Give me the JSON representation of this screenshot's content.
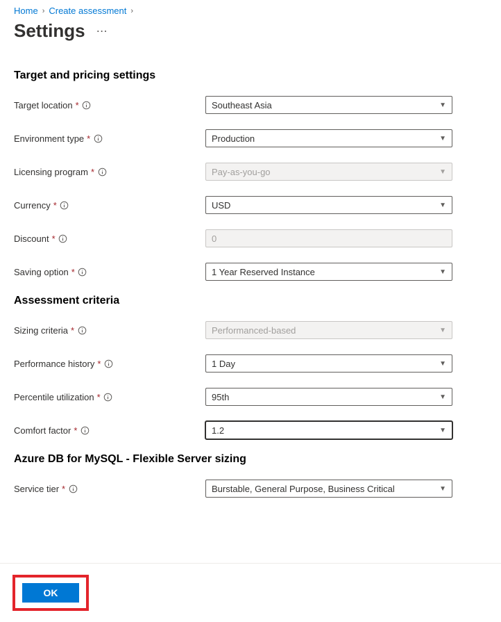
{
  "breadcrumb": {
    "home": "Home",
    "createAssessment": "Create assessment"
  },
  "pageTitle": "Settings",
  "section1": {
    "heading": "Target and pricing settings",
    "targetLocation": {
      "label": "Target location",
      "value": "Southeast Asia"
    },
    "environmentType": {
      "label": "Environment type",
      "value": "Production"
    },
    "licensingProgram": {
      "label": "Licensing program",
      "value": "Pay-as-you-go"
    },
    "currency": {
      "label": "Currency",
      "value": "USD"
    },
    "discount": {
      "label": "Discount",
      "value": "0"
    },
    "savingOption": {
      "label": "Saving option",
      "value": "1 Year Reserved Instance"
    }
  },
  "section2": {
    "heading": "Assessment criteria",
    "sizingCriteria": {
      "label": "Sizing criteria",
      "value": "Performanced-based"
    },
    "performanceHistory": {
      "label": "Performance history",
      "value": "1 Day"
    },
    "percentileUtilization": {
      "label": "Percentile utilization",
      "value": "95th"
    },
    "comfortFactor": {
      "label": "Comfort factor",
      "value": "1.2"
    }
  },
  "section3": {
    "heading": "Azure DB for MySQL - Flexible Server sizing",
    "serviceTier": {
      "label": "Service tier",
      "value": "Burstable, General Purpose, Business Critical"
    }
  },
  "footer": {
    "okLabel": "OK"
  }
}
